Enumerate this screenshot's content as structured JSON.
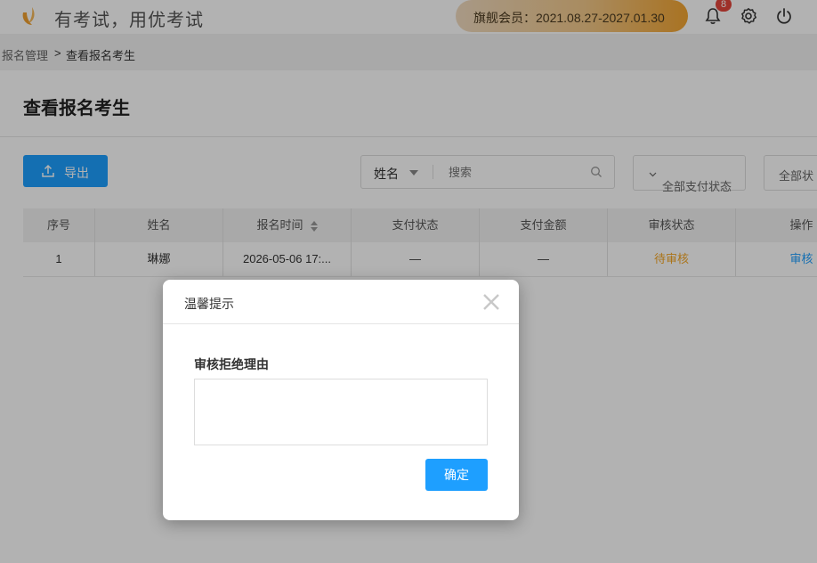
{
  "header": {
    "slogan": "有考试，用优考试",
    "membership": "旗舰会员：2021.08.27-2027.01.30",
    "notification_count": "8",
    "accent_color": "#1e9fff",
    "icons": [
      "logo-icon",
      "bell-icon",
      "gear-icon",
      "power-icon"
    ]
  },
  "breadcrumb": {
    "parent": "报名管理",
    "separator": ">",
    "current": "查看报名考生"
  },
  "page": {
    "title": "查看报名考生",
    "export_label": "导出",
    "search_field": "姓名",
    "search_placeholder": "搜索",
    "filter_payment": "全部支付状态",
    "filter_review": "全部状"
  },
  "table": {
    "headers": [
      "序号",
      "姓名",
      "报名时间",
      "支付状态",
      "支付金额",
      "审核状态",
      "操作"
    ],
    "rows": [
      [
        "1",
        "琳娜",
        "2026-05-06 17:...",
        "—",
        "—",
        "待审核",
        "审核"
      ]
    ]
  },
  "dialog": {
    "title": "温馨提示",
    "label": "审核拒绝理由",
    "textarea_value": "",
    "ok_label": "确定"
  }
}
